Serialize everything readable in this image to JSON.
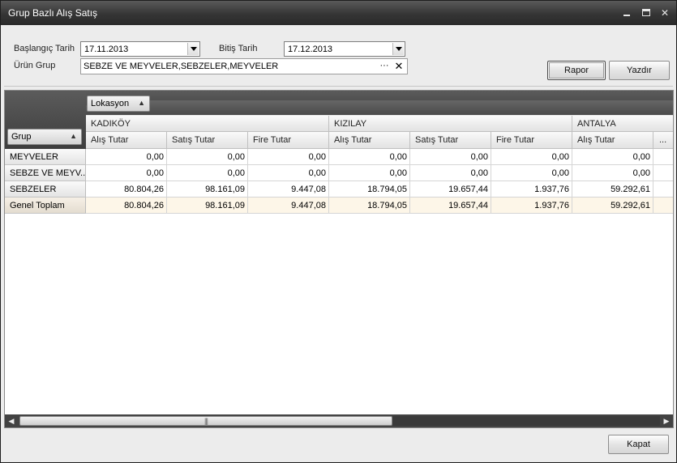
{
  "window": {
    "title": "Grup Bazlı Alış Satış"
  },
  "filters": {
    "start_label": "Başlangıç Tarih",
    "start_value": "17.11.2013",
    "end_label": "Bitiş Tarih",
    "end_value": "17.12.2013",
    "group_label": "Ürün Grup",
    "group_value": "SEBZE VE MEYVELER,SEBZELER,MEYVELER",
    "group_ellipsis": "···",
    "group_clear": "✕"
  },
  "buttons": {
    "report": "Rapor",
    "print": "Yazdır",
    "close": "Kapat"
  },
  "pivot": {
    "column_field": "Lokasyon",
    "row_field": "Grup",
    "locations": [
      "KADIKÖY",
      "KIZILAY",
      "ANTALYA"
    ],
    "measure_headers": [
      "Alış Tutar",
      "Satış Tutar",
      "Fire Tutar",
      "Alış Tutar",
      "Satış Tutar",
      "Fire Tutar",
      "Alış Tutar",
      "..."
    ],
    "rows": [
      {
        "label": "MEYVELER",
        "values": [
          "0,00",
          "0,00",
          "0,00",
          "0,00",
          "0,00",
          "0,00",
          "0,00"
        ]
      },
      {
        "label": "SEBZE VE MEYV...",
        "values": [
          "0,00",
          "0,00",
          "0,00",
          "0,00",
          "0,00",
          "0,00",
          "0,00"
        ]
      },
      {
        "label": "SEBZELER",
        "values": [
          "80.804,26",
          "98.161,09",
          "9.447,08",
          "18.794,05",
          "19.657,44",
          "1.937,76",
          "59.292,61"
        ]
      },
      {
        "label": "Genel Toplam",
        "values": [
          "80.804,26",
          "98.161,09",
          "9.447,08",
          "18.794,05",
          "19.657,44",
          "1.937,76",
          "59.292,61"
        ]
      }
    ]
  },
  "colors": {
    "titlebar": "#353535",
    "grand_total_bg": "#fdf6e8"
  }
}
